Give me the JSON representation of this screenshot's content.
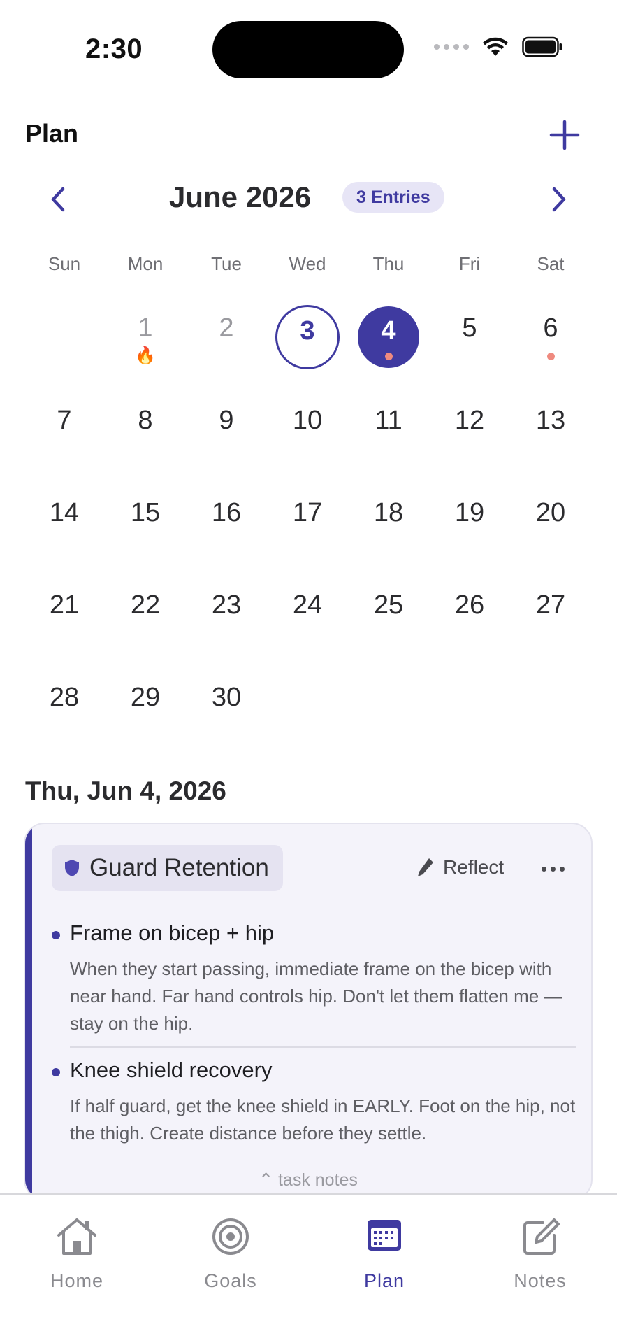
{
  "status_bar": {
    "time": "2:30"
  },
  "header": {
    "title": "Plan"
  },
  "month_nav": {
    "title": "June 2026",
    "entries_badge": "3 Entries"
  },
  "weekdays": [
    "Sun",
    "Mon",
    "Tue",
    "Wed",
    "Thu",
    "Fri",
    "Sat"
  ],
  "calendar": {
    "days": [
      {
        "num": "1",
        "col": 1,
        "row": 0,
        "muted": true,
        "streak": true
      },
      {
        "num": "2",
        "col": 2,
        "row": 0,
        "muted": true
      },
      {
        "num": "3",
        "col": 3,
        "row": 0,
        "today": true
      },
      {
        "num": "4",
        "col": 4,
        "row": 0,
        "selected": true,
        "dot": true
      },
      {
        "num": "5",
        "col": 5,
        "row": 0
      },
      {
        "num": "6",
        "col": 6,
        "row": 0,
        "dot": true
      },
      {
        "num": "7",
        "col": 0,
        "row": 1
      },
      {
        "num": "8",
        "col": 1,
        "row": 1
      },
      {
        "num": "9",
        "col": 2,
        "row": 1
      },
      {
        "num": "10",
        "col": 3,
        "row": 1
      },
      {
        "num": "11",
        "col": 4,
        "row": 1
      },
      {
        "num": "12",
        "col": 5,
        "row": 1
      },
      {
        "num": "13",
        "col": 6,
        "row": 1
      },
      {
        "num": "14",
        "col": 0,
        "row": 2
      },
      {
        "num": "15",
        "col": 1,
        "row": 2
      },
      {
        "num": "16",
        "col": 2,
        "row": 2
      },
      {
        "num": "17",
        "col": 3,
        "row": 2
      },
      {
        "num": "18",
        "col": 4,
        "row": 2
      },
      {
        "num": "19",
        "col": 5,
        "row": 2
      },
      {
        "num": "20",
        "col": 6,
        "row": 2
      },
      {
        "num": "21",
        "col": 0,
        "row": 3
      },
      {
        "num": "22",
        "col": 1,
        "row": 3
      },
      {
        "num": "23",
        "col": 2,
        "row": 3
      },
      {
        "num": "24",
        "col": 3,
        "row": 3
      },
      {
        "num": "25",
        "col": 4,
        "row": 3
      },
      {
        "num": "26",
        "col": 5,
        "row": 3
      },
      {
        "num": "27",
        "col": 6,
        "row": 3
      },
      {
        "num": "28",
        "col": 0,
        "row": 4
      },
      {
        "num": "29",
        "col": 1,
        "row": 4
      },
      {
        "num": "30",
        "col": 2,
        "row": 4
      }
    ]
  },
  "selected_date": "Thu, Jun 4, 2026",
  "card": {
    "goal_label": "Guard Retention",
    "reflect_label": "Reflect",
    "tasks": [
      {
        "title": "Frame on bicep + hip",
        "desc": "When they start passing, immediate frame on the bicep with near hand. Far hand controls hip. Don't let them flatten me — stay on the hip."
      },
      {
        "title": "Knee shield recovery",
        "desc": "If half guard, get the knee shield in EARLY. Foot on the hip, not the thigh. Create distance before they settle."
      }
    ],
    "task_notes_label": "task notes"
  },
  "tab_bar": {
    "tabs": [
      {
        "label": "Home",
        "icon": "house-icon"
      },
      {
        "label": "Goals",
        "icon": "target-icon"
      },
      {
        "label": "Plan",
        "icon": "calendar-icon",
        "active": true
      },
      {
        "label": "Notes",
        "icon": "compose-icon"
      }
    ]
  },
  "colors": {
    "accent": "#3f3aa0",
    "entry_dot": "#ef8a7f",
    "card_bg": "#f4f3fa"
  }
}
